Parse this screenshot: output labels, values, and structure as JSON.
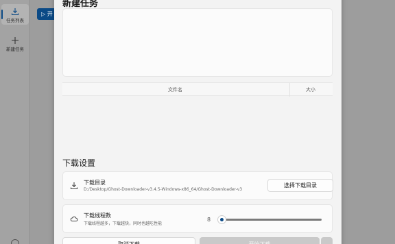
{
  "sidebar": {
    "items": [
      {
        "label": "任务列表",
        "icon": "download-icon"
      },
      {
        "label": "新建任务",
        "icon": "plus-icon"
      }
    ]
  },
  "background": {
    "start_label": "▷ 开"
  },
  "dialog": {
    "title": "新建任务",
    "url_placeholder": "",
    "table": {
      "col_name": "文件名",
      "col_size": "大小"
    },
    "section_title": "下载设置",
    "download_dir": {
      "title": "下载目录",
      "path": "D:/Desktop/Ghost-Downloader-v3.4.5-Windows-x86_64/Ghost-Downloader-v3",
      "button": "选择下载目录"
    },
    "threads": {
      "title": "下载线程数",
      "description": "下载线程越多，下载越快，同时也越吃性能",
      "value": "8",
      "level": 0.0
    },
    "cancel_label": "取消下载",
    "start_label": "开始下载"
  },
  "colors": {
    "accent": "#0b4a86",
    "dialog_bg": "#f3f3f3",
    "overlay": "#9d9d9d"
  }
}
